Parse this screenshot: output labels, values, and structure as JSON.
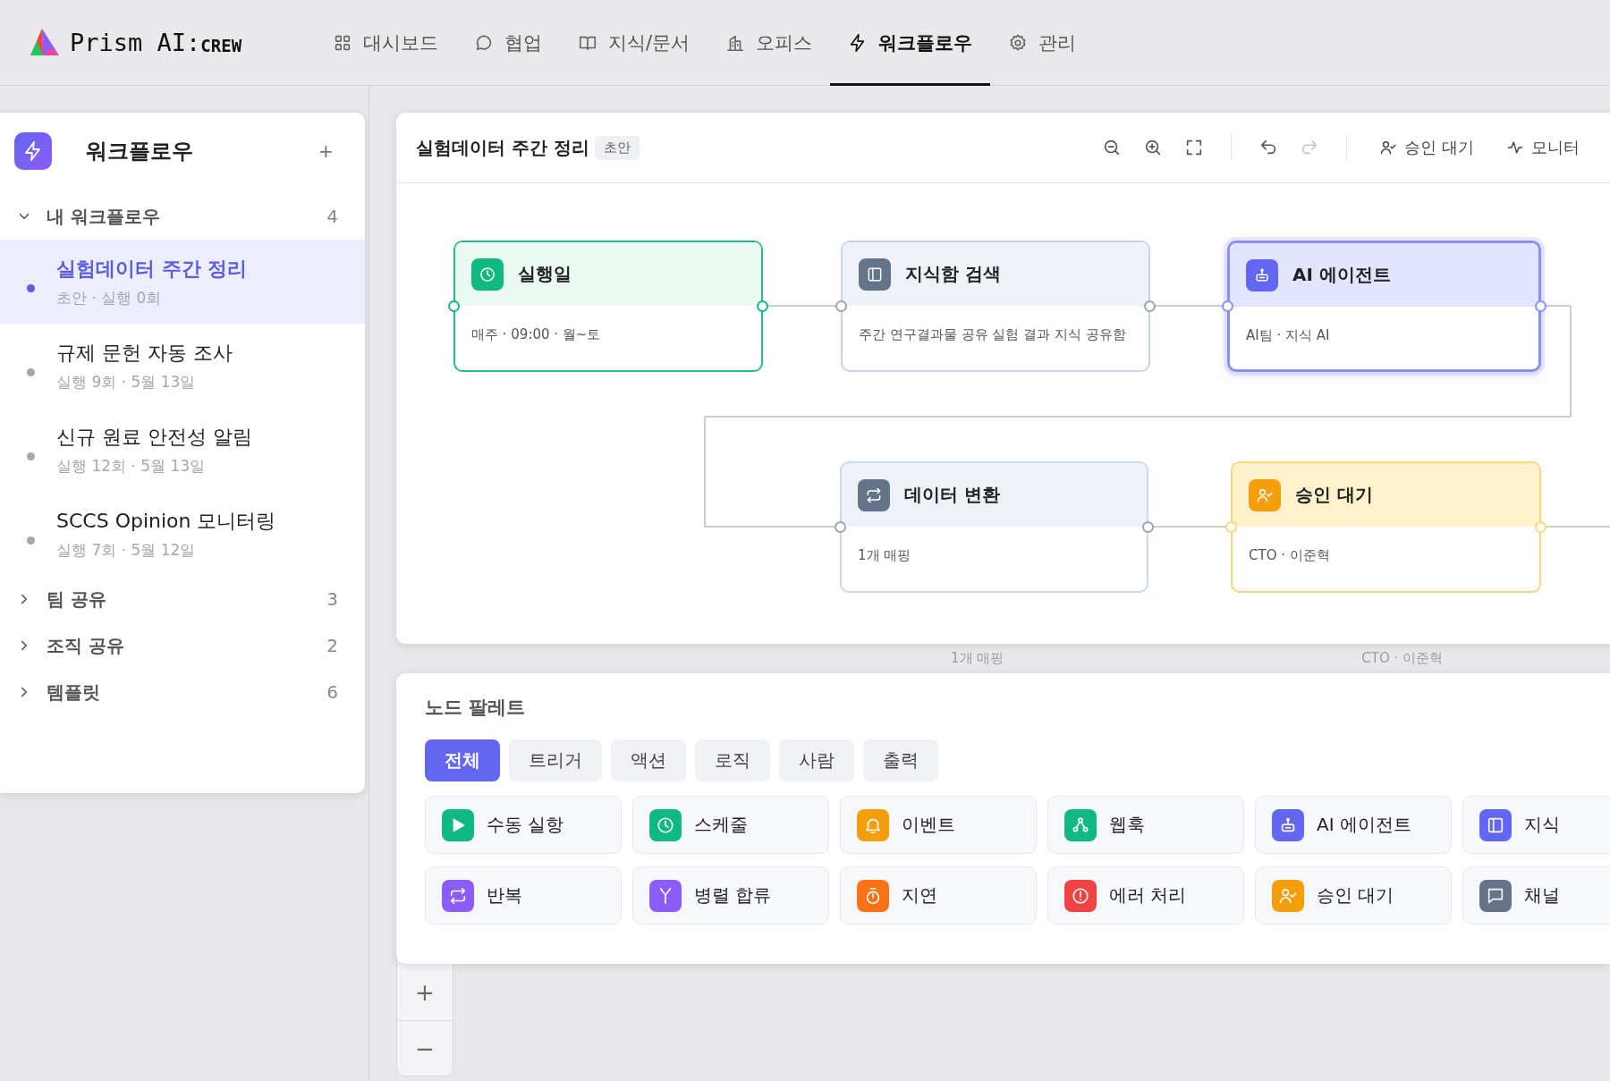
{
  "brand": {
    "name": "Prism AI:",
    "suffix": "CREW"
  },
  "nav": [
    {
      "label": "대시보드",
      "selected": false
    },
    {
      "label": "협업",
      "selected": false
    },
    {
      "label": "지식/문서",
      "selected": false
    },
    {
      "label": "오피스",
      "selected": false
    },
    {
      "label": "워크플로우",
      "selected": true
    },
    {
      "label": "관리",
      "selected": false
    }
  ],
  "sidebar": {
    "title": "워크플로우",
    "add": "+",
    "groups": [
      {
        "label": "내 워크플로우",
        "count": "4",
        "expanded": true,
        "items": [
          {
            "title": "실험데이터 주간 정리",
            "meta": "초안 · 실행 0회",
            "selected": true
          },
          {
            "title": "규제 문헌 자동 조사",
            "meta": "실행 9회 · 5월 13일",
            "selected": false
          },
          {
            "title": "신규 원료 안전성 알림",
            "meta": "실행 12회 · 5월 13일",
            "selected": false
          },
          {
            "title": "SCCS Opinion 모니터링",
            "meta": "실행 7회 · 5월 12일",
            "selected": false
          }
        ]
      },
      {
        "label": "팀 공유",
        "count": "3",
        "expanded": false
      },
      {
        "label": "조직 공유",
        "count": "2",
        "expanded": false
      },
      {
        "label": "템플릿",
        "count": "6",
        "expanded": false
      }
    ]
  },
  "editor": {
    "title": "실험데이터 주간 정리",
    "badge": "초안",
    "toolbar": {
      "redo_disabled": true,
      "approval": "승인 대기",
      "monitor": "모니터"
    },
    "nodes": [
      {
        "kind": "trigger",
        "title": "실행일",
        "detail": "매주 · 09:00 · 월~토",
        "selected": false
      },
      {
        "kind": "knowledge",
        "title": "지식함 검색",
        "detail": "주간 연구결과물 공유 실험 결과 지식 공유함",
        "selected": false
      },
      {
        "kind": "agent",
        "title": "AI 에이전트",
        "detail": "AI팀 · 지식 AI",
        "selected": true
      },
      {
        "kind": "transform",
        "title": "데이터 변환",
        "detail": "1개 매핑",
        "selected": false
      },
      {
        "kind": "approval",
        "title": "승인 대기",
        "detail": "CTO · 이준혁",
        "selected": false
      }
    ]
  },
  "background_nodes": [
    "1개 매핑",
    "CTO · 이준혁"
  ],
  "palette": {
    "title": "노드 팔레트",
    "tabs": [
      {
        "label": "전체",
        "selected": true
      },
      {
        "label": "트리거",
        "selected": false
      },
      {
        "label": "액션",
        "selected": false
      },
      {
        "label": "로직",
        "selected": false
      },
      {
        "label": "사람",
        "selected": false
      },
      {
        "label": "출력",
        "selected": false
      }
    ],
    "items": [
      {
        "kind": "manual",
        "label": "수동 실항",
        "color": "#10b981"
      },
      {
        "kind": "schedule",
        "label": "스케줄",
        "color": "#10b981"
      },
      {
        "kind": "event",
        "label": "이벤트",
        "color": "#f59e0b"
      },
      {
        "kind": "webhook",
        "label": "웹훅",
        "color": "#10b981"
      },
      {
        "kind": "agent",
        "label": "AI 에이전트",
        "color": "#6366f1"
      },
      {
        "kind": "knowledge",
        "label": "지식",
        "color": "#6366f1"
      },
      {
        "kind": "loop",
        "label": "반복",
        "color": "#8b5cf6"
      },
      {
        "kind": "parallel",
        "label": "병렬 합류",
        "color": "#8b5cf6"
      },
      {
        "kind": "delay",
        "label": "지연",
        "color": "#f97316"
      },
      {
        "kind": "error",
        "label": "에러 처리",
        "color": "#ef4444"
      },
      {
        "kind": "approval",
        "label": "승인 대기",
        "color": "#f59e0b"
      },
      {
        "kind": "channel",
        "label": "채널",
        "color": "#64748b"
      }
    ]
  },
  "zoom_control": {
    "plus": "+",
    "minus": "−"
  }
}
